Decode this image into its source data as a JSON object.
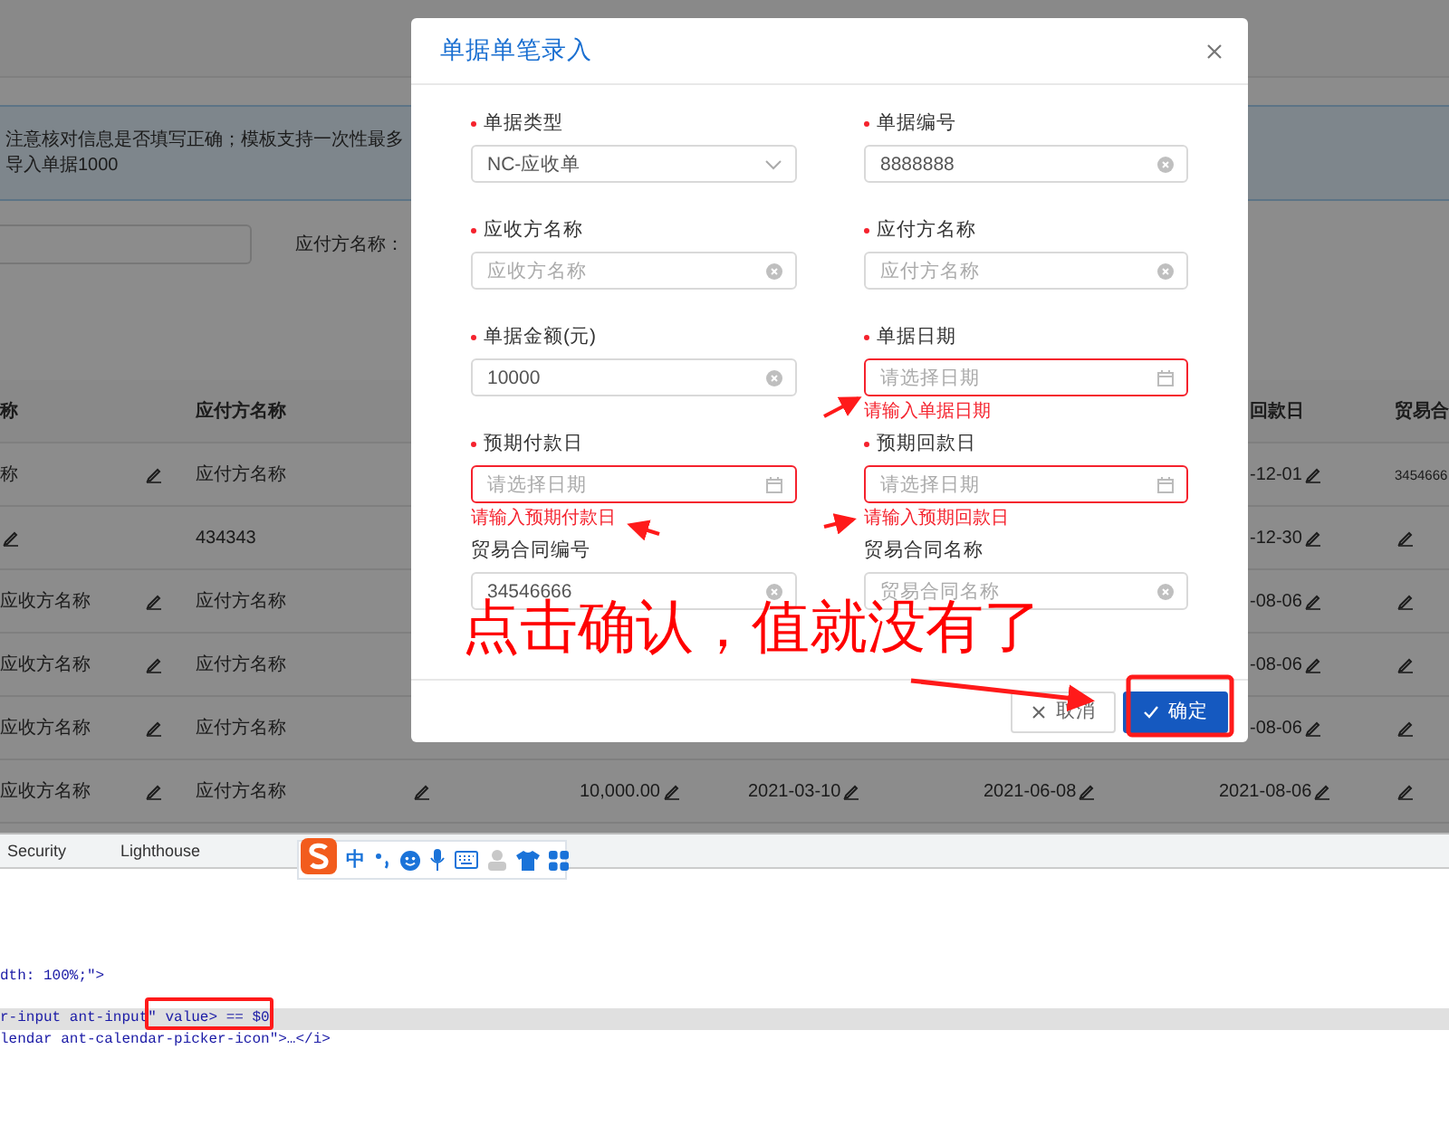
{
  "page": {
    "notice": "注意核对信息是否填写正确；模板支持一次性最多导入单据1000",
    "filter": {
      "label": "应付方名称："
    },
    "table": {
      "header": {
        "receiver": "称",
        "payer": "应付方名称",
        "return_date": "回款日",
        "contract_no": "贸易合"
      },
      "rows": [
        {
          "covered": true,
          "receiver": "称",
          "payer": "应付方名称",
          "return_date": "-12-01",
          "contract_no": "3454666"
        },
        {
          "covered": true,
          "payer": "434343",
          "return_date": "-12-30"
        },
        {
          "covered": true,
          "receiver": "应收方名称",
          "payer": "应付方名称",
          "return_date": "-08-06"
        },
        {
          "covered": true,
          "receiver": "应收方名称",
          "payer": "应付方名称",
          "return_date": "-08-06"
        },
        {
          "covered": true,
          "receiver": "应收方名称",
          "payer": "应付方名称",
          "return_date": "-08-06"
        },
        {
          "covered": false,
          "receiver": "应收方名称",
          "payer": "应付方名称",
          "amount": "10,000.00",
          "invoice_date": "2021-03-10",
          "pay_date": "2021-06-08",
          "return_date": "2021-08-06"
        }
      ]
    }
  },
  "dialog": {
    "title": "单据单笔录入",
    "fields": [
      {
        "kind": "select",
        "label": "单据类型",
        "required": true,
        "value": "NC-应收单"
      },
      {
        "kind": "text",
        "label": "单据编号",
        "required": true,
        "value": "8888888",
        "clearable": true
      },
      {
        "kind": "text",
        "label": "应收方名称",
        "required": true,
        "placeholder": "应收方名称",
        "clearable": true
      },
      {
        "kind": "text",
        "label": "应付方名称",
        "required": true,
        "placeholder": "应付方名称",
        "clearable": true
      },
      {
        "kind": "text",
        "label": "单据金额(元)",
        "required": true,
        "value": "10000",
        "clearable": true
      },
      {
        "kind": "date",
        "label": "单据日期",
        "required": true,
        "placeholder": "请选择日期",
        "error": "请输入单据日期"
      },
      {
        "kind": "date",
        "label": "预期付款日",
        "required": true,
        "placeholder": "请选择日期",
        "error": "请输入预期付款日"
      },
      {
        "kind": "date",
        "label": "预期回款日",
        "required": true,
        "placeholder": "请选择日期",
        "error": "请输入预期回款日"
      },
      {
        "kind": "text",
        "label": "贸易合同编号",
        "required": false,
        "value": "34546666",
        "clearable": true
      },
      {
        "kind": "text",
        "label": "贸易合同名称",
        "required": false,
        "placeholder": "贸易合同名称",
        "clearable": true
      }
    ],
    "buttons": [
      {
        "kind": "cancel",
        "label": "取消"
      },
      {
        "kind": "primary",
        "label": "确定"
      }
    ]
  },
  "annotation": {
    "note": "点击确认，值就没有了"
  },
  "devtools": {
    "tabs": [
      "Security",
      "Lighthouse"
    ],
    "code_lines": [
      {
        "text": "dth: 100%;\">",
        "highlighted": false
      },
      {
        "text": "r-input ant-input\" value> == $0",
        "highlighted": true
      },
      {
        "text": "lendar ant-calendar-picker-icon\">…</i>",
        "highlighted": false
      }
    ]
  },
  "ime_toolbar": {
    "mode": "中"
  }
}
